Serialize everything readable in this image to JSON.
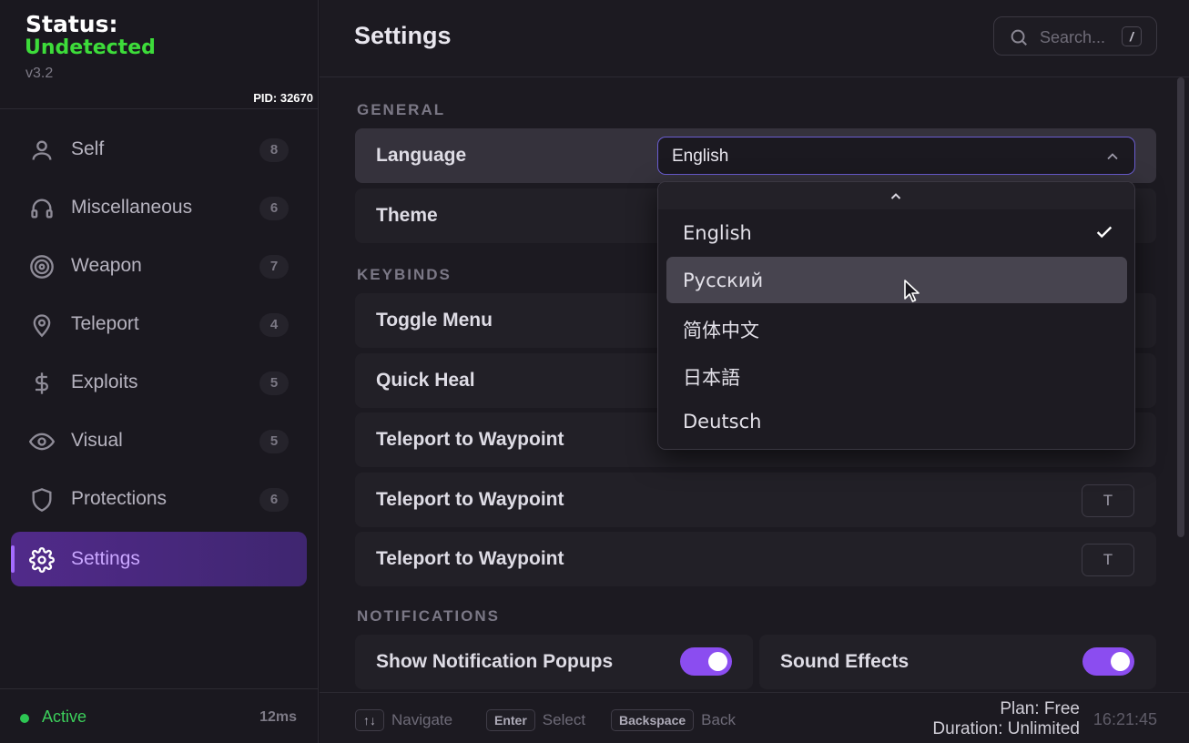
{
  "brand": {
    "status_label": "Status:",
    "status_value": "Undetected",
    "version": "v3.2",
    "pid": "PID: 32670",
    "status_color": "#3ddc3a"
  },
  "nav": {
    "items": [
      {
        "label": "Self",
        "count": "8",
        "icon": "user-icon"
      },
      {
        "label": "Miscellaneous",
        "count": "6",
        "icon": "headphones-icon"
      },
      {
        "label": "Weapon",
        "count": "7",
        "icon": "target-icon"
      },
      {
        "label": "Teleport",
        "count": "4",
        "icon": "map-pin-icon"
      },
      {
        "label": "Exploits",
        "count": "5",
        "icon": "dollar-icon"
      },
      {
        "label": "Visual",
        "count": "5",
        "icon": "eye-icon"
      },
      {
        "label": "Protections",
        "count": "6",
        "icon": "shield-icon"
      },
      {
        "label": "Settings",
        "count": "",
        "icon": "gear-icon",
        "active": true
      }
    ]
  },
  "sidebar_footer": {
    "status": "Active",
    "ping": "12ms"
  },
  "header": {
    "title": "Settings",
    "search_placeholder": "Search...",
    "search_shortcut": "/"
  },
  "sections": {
    "general": "GENERAL",
    "keybinds": "KEYBINDS",
    "notifications": "NOTIFICATIONS"
  },
  "general": {
    "language_label": "Language",
    "language_value": "English",
    "theme_label": "Theme"
  },
  "keybinds": [
    {
      "label": "Toggle Menu",
      "key": ""
    },
    {
      "label": "Quick Heal",
      "key": ""
    },
    {
      "label": "Teleport to Waypoint",
      "key": ""
    },
    {
      "label": "Teleport to Waypoint",
      "key": "T"
    },
    {
      "label": "Teleport to Waypoint",
      "key": "T"
    }
  ],
  "notifications": {
    "popups_label": "Show Notification Popups",
    "popups_on": true,
    "sound_label": "Sound Effects",
    "sound_on": true
  },
  "language_dropdown": {
    "options": [
      "English",
      "Русский",
      "简体中文",
      "日本語",
      "Deutsch"
    ],
    "selected": "English",
    "hovered": "Русский"
  },
  "footer": {
    "hints": [
      {
        "key": "↑↓",
        "label": "Navigate"
      },
      {
        "key": "Enter",
        "label": "Select"
      },
      {
        "key": "Backspace",
        "label": "Back"
      }
    ],
    "plan": "Plan: Free",
    "duration": "Duration: Unlimited",
    "time": "16:21:45"
  },
  "colors": {
    "accent": "#8b4df0",
    "active_nav": "#512a8a",
    "online": "#2dc653"
  }
}
